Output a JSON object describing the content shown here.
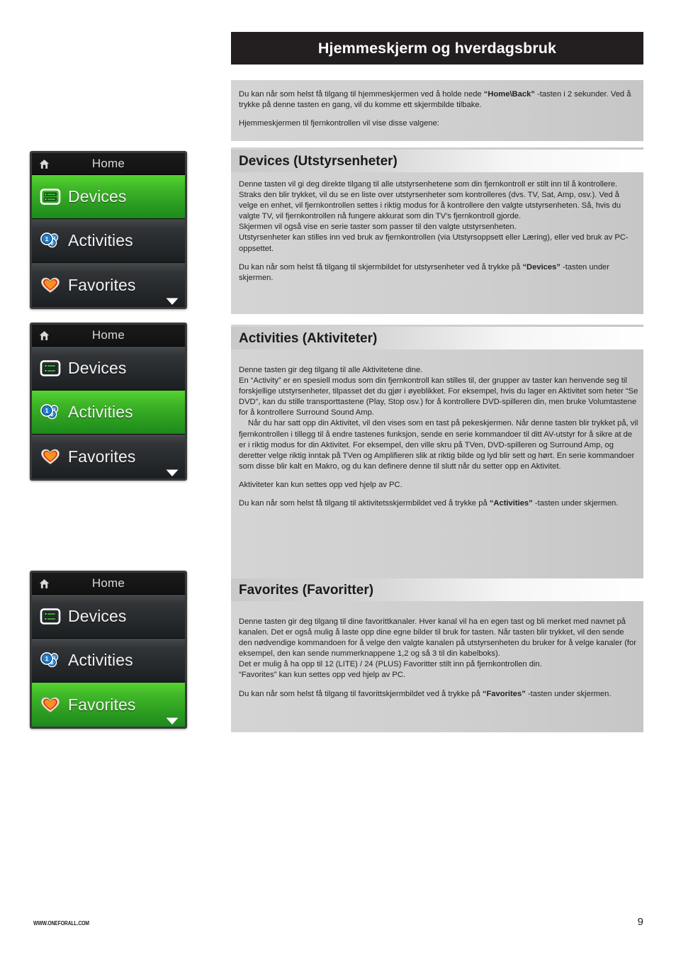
{
  "header": {
    "title": "Hjemmeskjerm og hverdagsbruk"
  },
  "intro": {
    "p1_a": "Du kan når som helst få tilgang til hjemmeskjermen ved å holde nede ",
    "p1_b": "“Home\\Back”",
    "p1_c": " -tasten i 2 sekunder. Ved å trykke på denne tasten en gang, vil du komme ett skjermbilde tilbake.",
    "p2": "Hjemmeskjermen til fjernkontrollen vil vise disse valgene:"
  },
  "sections": {
    "devices": {
      "heading": "Devices (Utstyrsenheter)",
      "p1": "Denne tasten vil gi deg direkte tilgang til alle utstyrsenhetene som din fjernkontroll er stilt inn til å kontrollere.  Straks den blir trykket, vil du se en liste over utstyrsenheter som kontrolleres (dvs. TV, Sat, Amp, osv.). Ved å velge en enhet, vil fjernkontrollen settes i riktig modus for å kontrollere den valgte utstyrsenheten.  Så, hvis du valgte TV, vil fjernkontrollen nå fungere akkurat som din TV's fjernkontroll gjorde.",
      "p2": "Skjermen vil også vise en serie taster som passer til den valgte utstyrsenheten.",
      "p3": "Utstyrsenheter kan stilles inn ved bruk av fjernkontrollen (via Utstyrsoppsett eller Læring), eller ved bruk av PC-oppsettet.",
      "p4_a": "Du kan når som helst få tilgang til skjermbildet for utstyrsenheter ved å trykke på ",
      "p4_b": "“Devices”",
      "p4_c": " -tasten under skjermen."
    },
    "activities": {
      "heading": "Activities (Aktiviteter)",
      "p1": "Denne tasten gir deg tilgang til alle Aktivitetene dine.",
      "p2": "En “Activity” er en spesiell modus som din fjernkontroll kan stilles til, der grupper av taster kan henvende seg til forskjellige utstyrsenheter, tilpasset det du gjør i øyeblikket. For eksempel, hvis du lager en Aktivitet som heter “Se DVD”, kan du stille transporttastene (Play, Stop osv.) for å kontrollere DVD-spilleren din, men bruke Volumtastene for å kontrollere Surround Sound Amp.",
      "p3": "Når du har satt opp din Aktivitet, vil den vises som en tast på pekeskjermen. Når denne tasten blir trykket på, vil fjernkontrollen i tillegg til å endre tastenes funksjon, sende en serie kommandoer til ditt AV-utstyr for å sikre at de er i riktig modus for din Aktivitet. For eksempel, den ville skru på TVen, DVD-spilleren og Surround Amp, og deretter velge riktig inntak på TVen og Amplifieren slik at riktig bilde og lyd blir sett og hørt. En serie kommandoer som disse blir kalt en Makro, og du kan definere denne til slutt når du setter opp en Aktivitet.",
      "p4": "Aktiviteter kan kun settes opp ved hjelp av PC.",
      "p5_a": "Du kan når som helst få tilgang til aktivitetsskjermbildet ved å trykke på ",
      "p5_b": "“Activities”",
      "p5_c": " -tasten under skjermen."
    },
    "favorites": {
      "heading": "Favorites (Favoritter)",
      "p1": "Denne tasten gir deg tilgang til dine favorittkanaler. Hver kanal vil ha en egen tast og bli merket med navnet på kanalen.  Det er også mulig å laste opp dine egne bilder til bruk for tasten. Når tasten blir trykket, vil den sende den nødvendige kommandoen for å velge den valgte kanalen på utstyrsenheten du bruker for å velge kanaler (for eksempel, den kan sende nummerknappene 1,2 og så 3 til din kabelboks).",
      "p2": "Det er mulig å ha opp til 12 (LITE) / 24 (PLUS) Favoritter stilt inn på fjernkontrollen din.",
      "p3": "“Favorites” kan kun settes opp ved hjelp av PC.",
      "p4_a": "Du kan når som helst få tilgang til favorittskjermbildet ved å trykke på ",
      "p4_b": "“Favorites”",
      "p4_c": " -tasten under skjermen."
    }
  },
  "remote_screens": [
    {
      "header_label": "Home",
      "header_icon": "home-icon",
      "selected": "Devices",
      "rows": [
        {
          "label": "Devices",
          "icon": "devices-icon",
          "active": true
        },
        {
          "label": "Activities",
          "icon": "activities-icon",
          "active": false
        },
        {
          "label": "Favorites",
          "icon": "heart-icon",
          "active": false
        }
      ],
      "scroll_icon": "chevron-down-icon"
    },
    {
      "header_label": "Home",
      "header_icon": "home-icon",
      "selected": "Activities",
      "rows": [
        {
          "label": "Devices",
          "icon": "devices-icon",
          "active": false
        },
        {
          "label": "Activities",
          "icon": "activities-icon",
          "active": true
        },
        {
          "label": "Favorites",
          "icon": "heart-icon",
          "active": false
        }
      ],
      "scroll_icon": "chevron-down-icon"
    },
    {
      "header_label": "Home",
      "header_icon": "home-icon",
      "selected": "Favorites",
      "rows": [
        {
          "label": "Devices",
          "icon": "devices-icon",
          "active": false
        },
        {
          "label": "Activities",
          "icon": "activities-icon",
          "active": false
        },
        {
          "label": "Favorites",
          "icon": "heart-icon",
          "active": true
        }
      ],
      "scroll_icon": "chevron-down-icon"
    }
  ],
  "footer": {
    "url": "WWW.ONEFORALL.COM",
    "page_number": "9"
  },
  "colors": {
    "banner_bg": "#231f20",
    "accent_green": "#3fb628",
    "heart_orange": "#f07a1a",
    "activity_blue": "#1d7fd4"
  }
}
